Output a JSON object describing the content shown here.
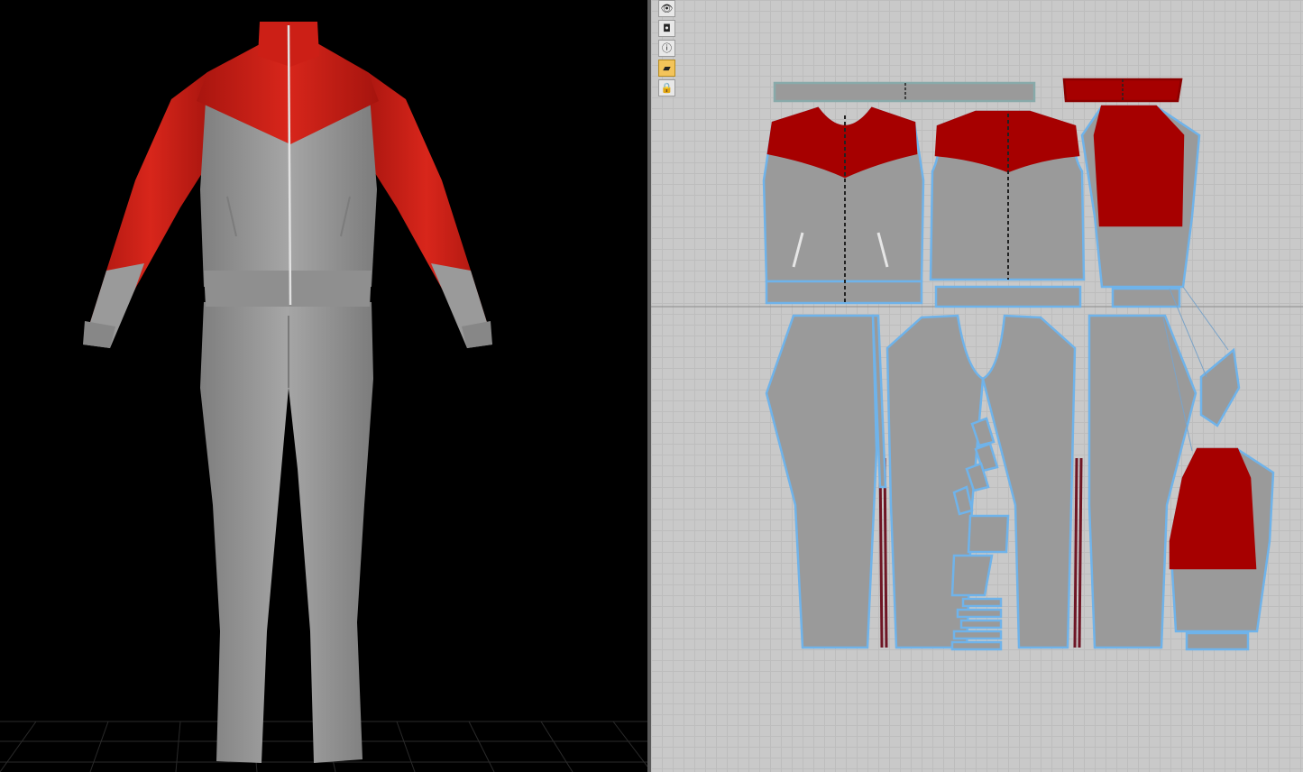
{
  "colors": {
    "fabric_gray": "#9a9a9a",
    "fabric_gray_light": "#a3a3a3",
    "accent_red": "#c81d14",
    "pattern_red": "#a60000",
    "pattern_outline": "#6fb3ea",
    "background_3d": "#000000",
    "background_2d": "#c9c9c9"
  },
  "viewport_3d": {
    "grid_floor": true,
    "garment": [
      "zip-track-jacket",
      "track-pants"
    ]
  },
  "viewport_2d": {
    "toolbar": [
      {
        "icon": "eye-icon",
        "glyph": "👁",
        "active": false
      },
      {
        "icon": "camera-icon",
        "glyph": "◘",
        "active": false
      },
      {
        "icon": "info-icon",
        "glyph": "ⓘ",
        "active": false
      },
      {
        "icon": "layers-icon",
        "glyph": "▰",
        "active": true
      },
      {
        "icon": "lock-icon",
        "glyph": "🔒",
        "active": false
      }
    ],
    "pattern_pieces": [
      "collar",
      "neck-band",
      "front-left",
      "back",
      "sleeve-top",
      "pants-front-left",
      "pants-back-left",
      "pants-back-right",
      "pants-front-right",
      "pocket-bags",
      "waist-bands",
      "sleeve-bottom",
      "cuff"
    ]
  }
}
